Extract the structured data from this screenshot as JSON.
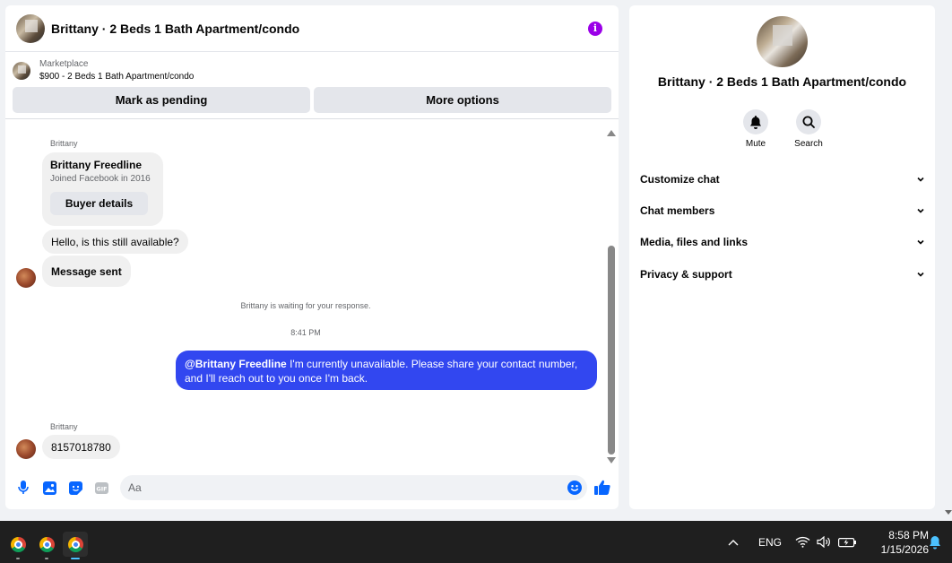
{
  "header": {
    "title": "Brittany · 2 Beds 1 Bath Apartment/condo",
    "info_icon": "info-icon",
    "accent": "#9b00e8"
  },
  "listing": {
    "category": "Marketplace",
    "price_title": "$900 - 2 Beds 1 Bath Apartment/condo",
    "mark_pending": "Mark as pending",
    "more_options": "More options"
  },
  "messages": {
    "sender1": "Brittany",
    "card_name": "Brittany Freedline",
    "card_sub": "Joined Facebook in 2016",
    "buyer_details": "Buyer details",
    "msg1": "Hello, is this still available?",
    "msg2": "Message sent",
    "waiting_note": "Brittany is waiting for your response.",
    "timestamp": "8:41 PM",
    "out_mention": "@Brittany Freedline",
    "out_text": " I'm currently unavailable. Please share your contact number, and I'll reach out to you once I'm back.",
    "sender2": "Brittany",
    "msg3": "8157018780",
    "outgoing_color": "#3247f0"
  },
  "composer": {
    "placeholder": "Aa"
  },
  "info_panel": {
    "title": "Brittany · 2 Beds 1 Bath Apartment/condo",
    "mute": "Mute",
    "search": "Search",
    "sections": [
      "Customize chat",
      "Chat members",
      "Media, files and links",
      "Privacy & support"
    ]
  },
  "taskbar": {
    "language": "ENG",
    "time": "8:58 PM",
    "date": "1/15/2026"
  }
}
